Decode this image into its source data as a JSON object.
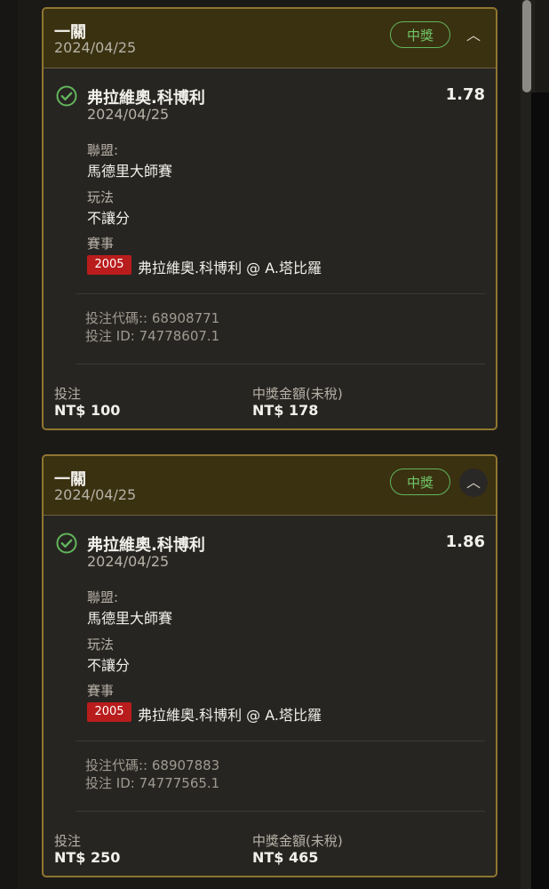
{
  "bets": [
    {
      "header_title": "一關",
      "header_date": "2024/04/25",
      "status": "中獎",
      "selection_name": "弗拉維奧.科博利",
      "selection_date": "2024/04/25",
      "odds": "1.78",
      "league_label": "聯盟:",
      "league_value": "馬德里大師賽",
      "market_label": "玩法",
      "market_value": "不讓分",
      "event_label": "賽事",
      "event_code": "2005",
      "event_name": "弗拉維奧.科博利 @ A.塔比羅",
      "bet_code": "投注代碼:: 68908771",
      "bet_id": "投注 ID: 74778607.1",
      "stake_label": "投注",
      "stake_value": "NT$ 100",
      "payout_label": "中獎金額(未稅)",
      "payout_value": "NT$ 178"
    },
    {
      "header_title": "一關",
      "header_date": "2024/04/25",
      "status": "中獎",
      "selection_name": "弗拉維奧.科博利",
      "selection_date": "2024/04/25",
      "odds": "1.86",
      "league_label": "聯盟:",
      "league_value": "馬德里大師賽",
      "market_label": "玩法",
      "market_value": "不讓分",
      "event_label": "賽事",
      "event_code": "2005",
      "event_name": "弗拉維奧.科博利 @ A.塔比羅",
      "bet_code": "投注代碼:: 68907883",
      "bet_id": "投注 ID: 74777565.1",
      "stake_label": "投注",
      "stake_value": "NT$ 250",
      "payout_label": "中獎金額(未稅)",
      "payout_value": "NT$ 465"
    }
  ],
  "icons": {
    "collapse": "chevron-up-icon",
    "won": "check-circle-icon"
  },
  "colors": {
    "accent_border": "#8f7630",
    "header_bg": "#3a3111",
    "win_green": "#62b55c",
    "event_code_red": "#b91c1c"
  }
}
